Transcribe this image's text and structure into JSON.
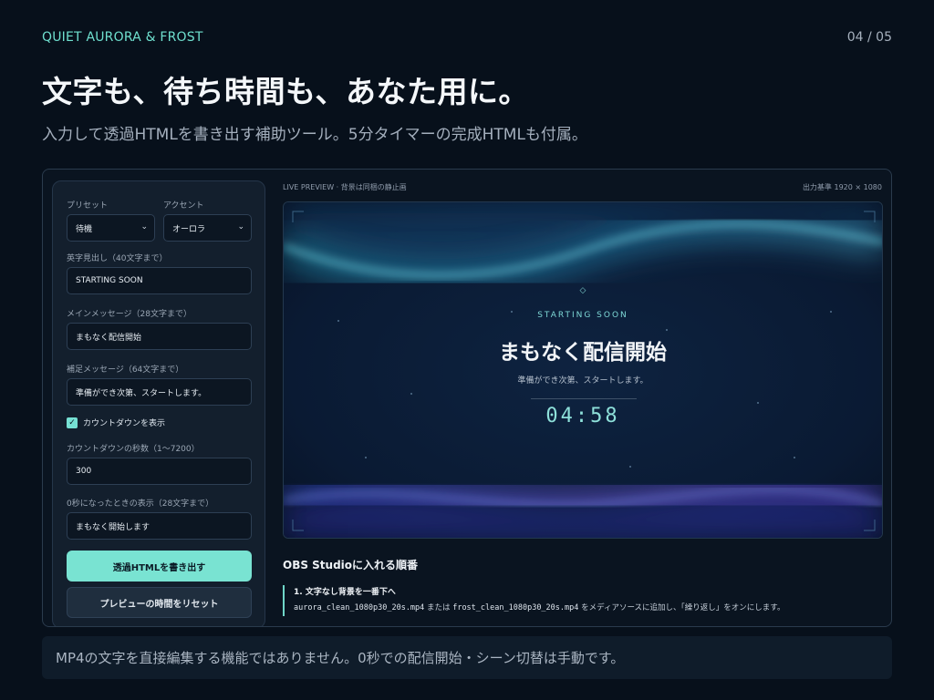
{
  "brand": "QUIET AURORA & FROST",
  "page_number": "04 / 05",
  "headline": "文字も、待ち時間も、あなた用に。",
  "subheadline": "入力して透過HTMLを書き出す補助ツール。5分タイマーの完成HTMLも付属。",
  "form": {
    "preset_label": "プリセット",
    "preset_value": "待機",
    "accent_label": "アクセント",
    "accent_value": "オーロラ",
    "eyebrow_label": "英字見出し（40文字まで）",
    "eyebrow_value": "STARTING SOON",
    "main_label": "メインメッセージ（28文字まで）",
    "main_value": "まもなく配信開始",
    "sub_label": "補足メッセージ（64文字まで）",
    "sub_value": "準備ができ次第、スタートします。",
    "countdown_checkbox_label": "カウントダウンを表示",
    "countdown_checked": true,
    "seconds_label": "カウントダウンの秒数（1〜7200）",
    "seconds_value": "300",
    "zero_label": "0秒になったときの表示（28文字まで）",
    "zero_value": "まもなく開始します",
    "export_button": "透過HTMLを書き出す",
    "reset_button": "プレビューの時間をリセット"
  },
  "preview": {
    "label": "LIVE PREVIEW · 背景は同梱の静止画",
    "resolution": "出力基準 1920 × 1080",
    "diamond": "◇",
    "eyebrow": "STARTING SOON",
    "main": "まもなく配信開始",
    "sub": "準備ができ次第、スタートします。",
    "timer": "04:58"
  },
  "obs": {
    "title": "OBS Studioに入れる順番",
    "step1_title": "1. 文字なし背景を一番下へ",
    "step1_file1": "aurora_clean_1080p30_20s.mp4",
    "step1_or": " または ",
    "step1_file2": "frost_clean_1080p30_20s.mp4",
    "step1_rest": " をメディアソースに追加し、「繰り返し」をオンにします。"
  },
  "footer": "MP4の文字を直接編集する機能ではありません。0秒での配信開始・シーン切替は手動です。",
  "colors": {
    "accent": "#6fe0cf",
    "background": "#07101b",
    "primary_button": "#79e3d2"
  }
}
